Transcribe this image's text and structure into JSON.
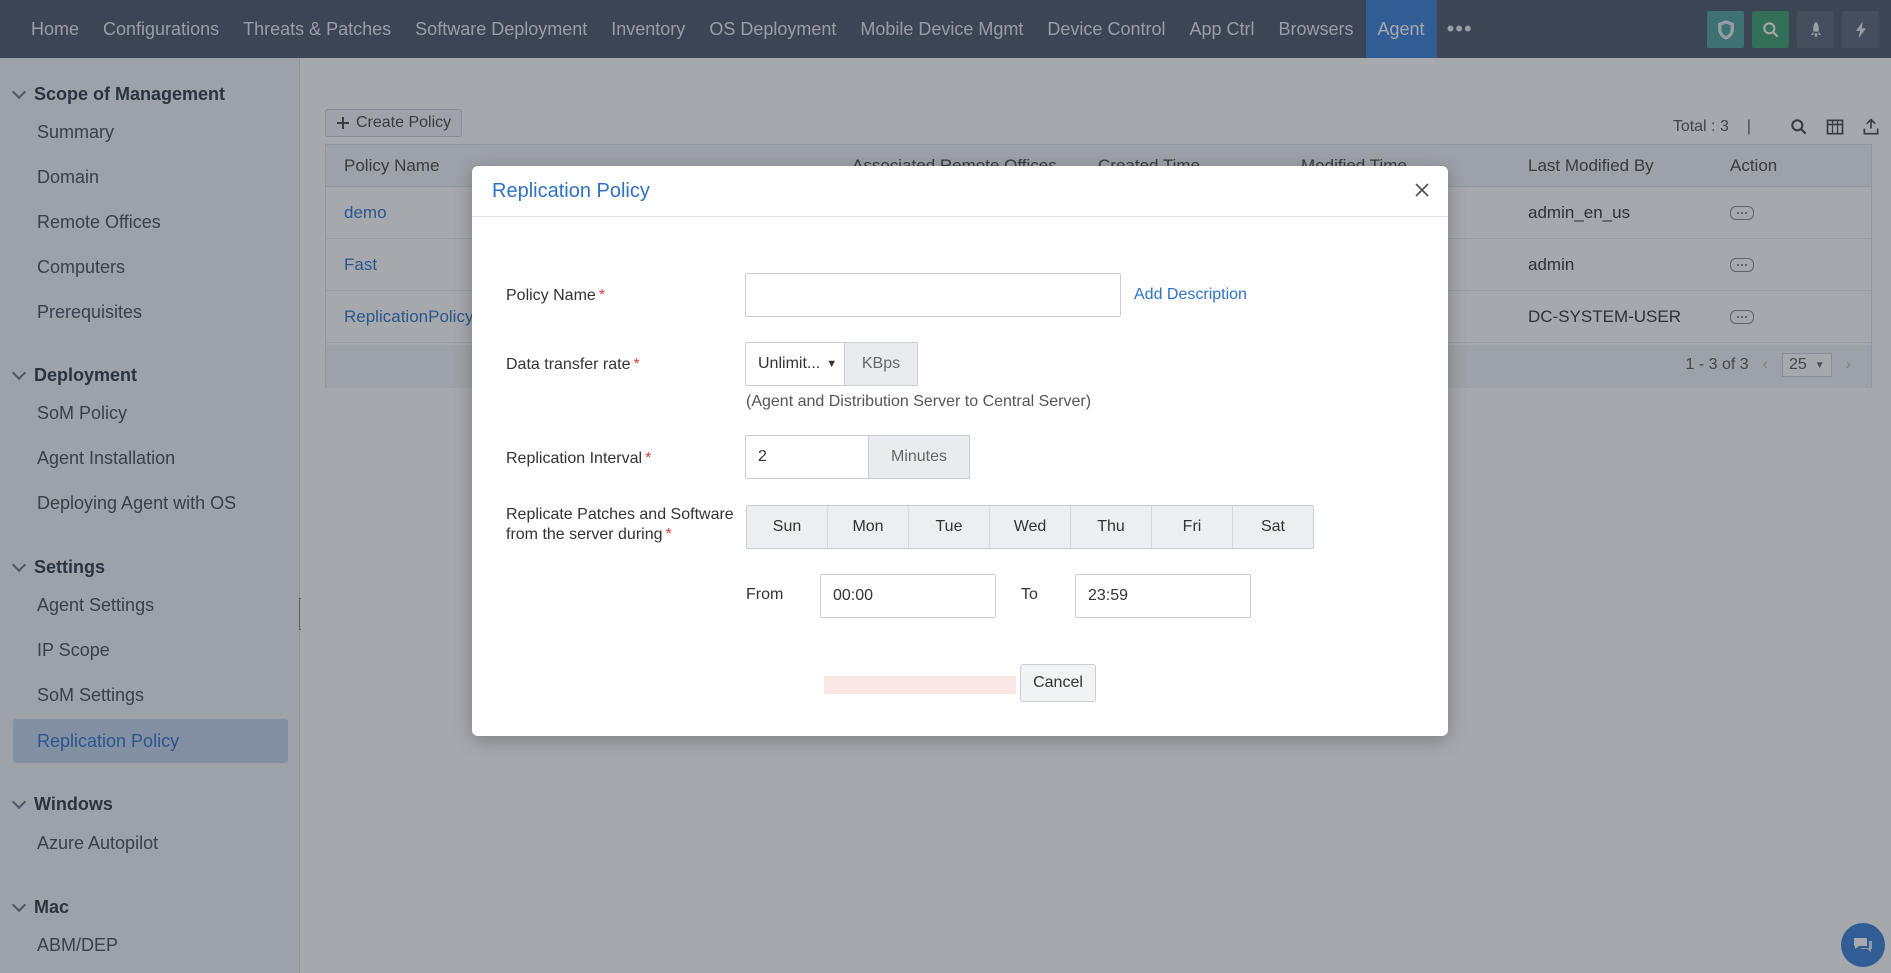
{
  "topnav": {
    "items": [
      "Home",
      "Configurations",
      "Threats & Patches",
      "Software Deployment",
      "Inventory",
      "OS Deployment",
      "Mobile Device Mgmt",
      "Device Control",
      "App Ctrl",
      "Browsers",
      "Agent"
    ],
    "more": "•••",
    "active_index": 10,
    "icons": [
      "shield-icon",
      "search-icon",
      "rocket-icon",
      "lightning-icon"
    ]
  },
  "sidebar": {
    "sections": [
      {
        "title": "Scope of Management",
        "items": [
          "Summary",
          "Domain",
          "Remote Offices",
          "Computers",
          "Prerequisites"
        ]
      },
      {
        "title": "Deployment",
        "items": [
          "SoM Policy",
          "Agent Installation",
          "Deploying Agent with OS"
        ]
      },
      {
        "title": "Settings",
        "items": [
          "Agent Settings",
          "IP Scope",
          "SoM Settings",
          "Replication Policy"
        ]
      },
      {
        "title": "Windows",
        "items": [
          "Azure Autopilot"
        ]
      },
      {
        "title": "Mac",
        "items": [
          "ABM/DEP"
        ]
      }
    ],
    "selected": "Replication Policy"
  },
  "main": {
    "create_button": "Create Policy",
    "total": "Total : 3",
    "separator": "|",
    "table": {
      "headers": [
        "Policy Name",
        "Associated Remote Offices",
        "Created Time",
        "Modified Time",
        "Last Modified By",
        "Action"
      ],
      "rows": [
        {
          "name": "demo",
          "modified_by": "admin_en_us"
        },
        {
          "name": "Fast",
          "modified_by": "admin"
        },
        {
          "name": "ReplicationPolicy(",
          "modified_by": "DC-SYSTEM-USER"
        }
      ]
    },
    "pager": {
      "range": "1 - 3 of 3",
      "page_size": "25"
    }
  },
  "modal": {
    "title": "Replication Policy",
    "policy_name_label": "Policy Name",
    "policy_name_value": "",
    "add_description": "Add Description",
    "transfer_rate_label": "Data transfer rate",
    "transfer_rate_value": "Unlimit...",
    "transfer_rate_unit": "KBps",
    "transfer_hint": "(Agent and Distribution Server to Central Server)",
    "interval_label": "Replication Interval",
    "interval_value": "2",
    "interval_unit": "Minutes",
    "replicate_label_line1": "Replicate Patches and Software",
    "replicate_label_line2": "from the server during",
    "days": [
      "Sun",
      "Mon",
      "Tue",
      "Wed",
      "Thu",
      "Fri",
      "Sat"
    ],
    "from_label": "From",
    "from_value": "00:00",
    "to_label": "To",
    "to_value": "23:59",
    "cancel": "Cancel",
    "required_mark": "*"
  },
  "colors": {
    "accent": "#2f72c4",
    "nav_bg": "#4a5566",
    "required": "#e04040"
  }
}
